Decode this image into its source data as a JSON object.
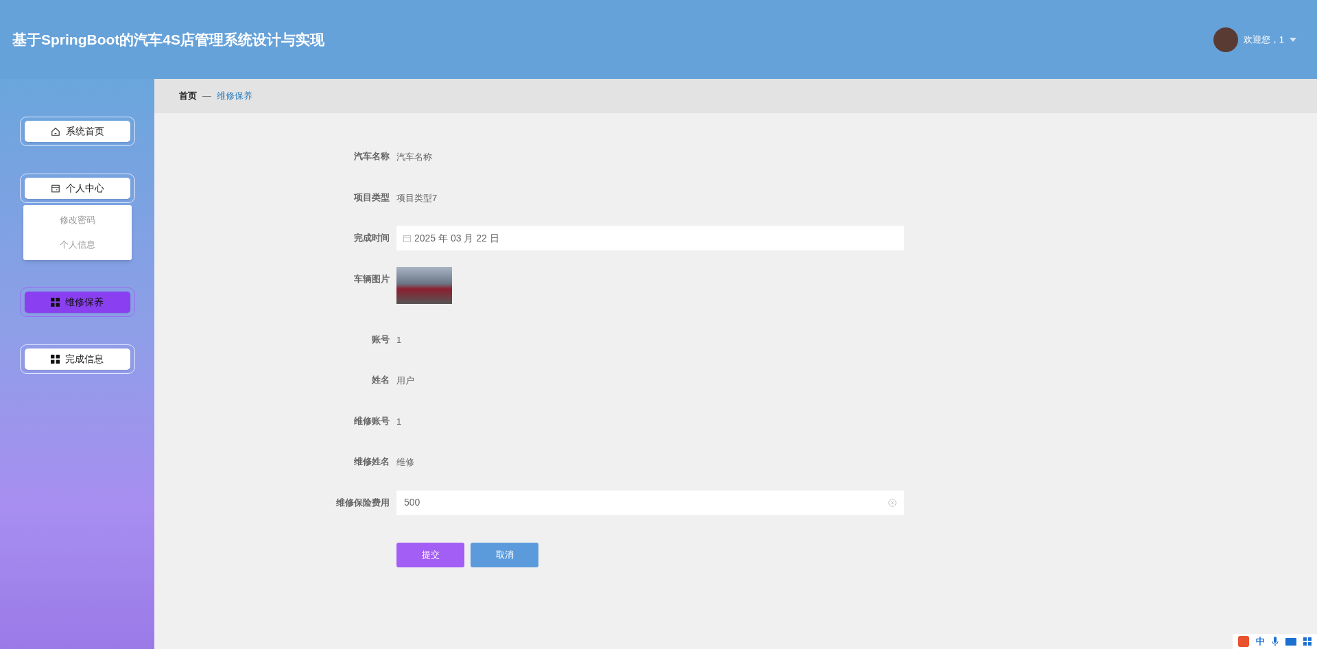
{
  "header": {
    "title": "基于SpringBoot的汽车4S店管理系统设计与实现",
    "welcome": "欢迎您，1"
  },
  "sidebar": {
    "items": [
      {
        "label": "系统首页",
        "kind": "home",
        "selected": false
      },
      {
        "label": "个人中心",
        "kind": "card",
        "selected": false,
        "expanded": true,
        "children": [
          {
            "label": "修改密码"
          },
          {
            "label": "个人信息"
          }
        ]
      },
      {
        "label": "维修保养",
        "kind": "grid",
        "selected": true
      },
      {
        "label": "完成信息",
        "kind": "grid",
        "selected": false
      }
    ]
  },
  "breadcrumb": {
    "home": "首页",
    "separator": "—",
    "current": "维修保养"
  },
  "form": {
    "fields": [
      {
        "label": "汽车名称",
        "kind": "text",
        "value": "汽车名称"
      },
      {
        "label": "项目类型",
        "kind": "text",
        "value": "项目类型7"
      },
      {
        "label": "完成时间",
        "kind": "date",
        "value": "2025 年 03 月 22 日"
      },
      {
        "label": "车辆图片",
        "kind": "image"
      },
      {
        "label": "账号",
        "kind": "text",
        "value": "1"
      },
      {
        "label": "姓名",
        "kind": "text",
        "value": "用户"
      },
      {
        "label": "维修账号",
        "kind": "text",
        "value": "1"
      },
      {
        "label": "维修姓名",
        "kind": "text",
        "value": "维修"
      },
      {
        "label": "维修保险费用",
        "kind": "input",
        "value": "500"
      }
    ],
    "buttons": [
      {
        "label": "提交",
        "kind": "primary"
      },
      {
        "label": "取消",
        "kind": "secondary"
      }
    ]
  },
  "ime_bar": {
    "mode": "中"
  }
}
